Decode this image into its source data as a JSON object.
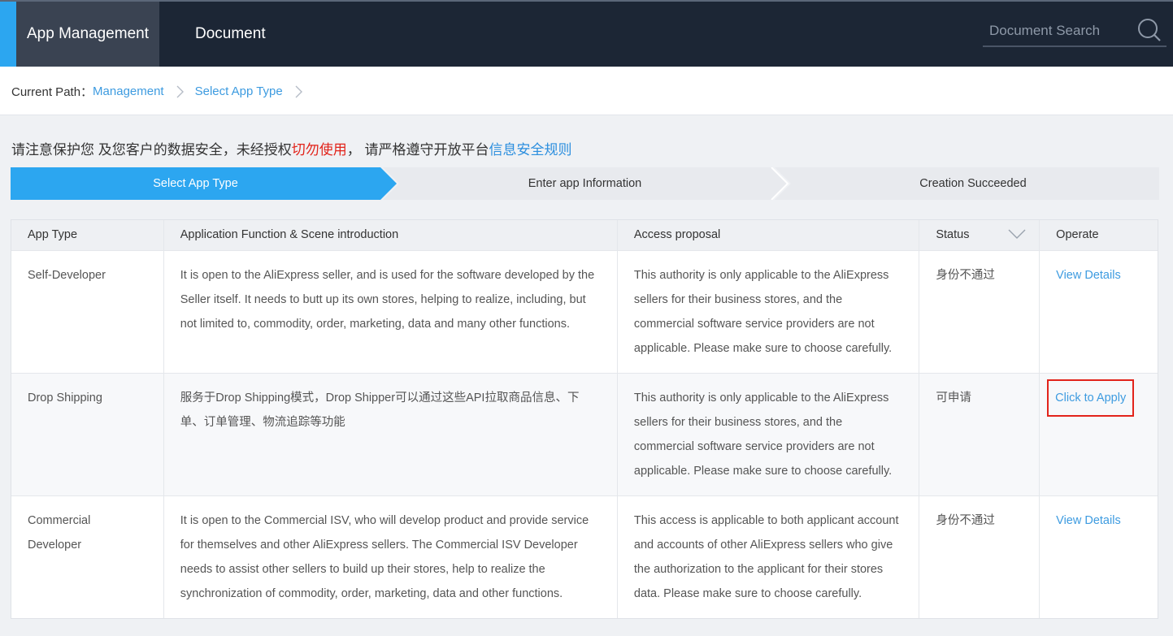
{
  "nav": {
    "items": [
      {
        "label": "App Management",
        "active": true
      },
      {
        "label": "Document",
        "active": false
      }
    ],
    "search_placeholder": "Document Search"
  },
  "breadcrumb": {
    "prefix": "Current Path：",
    "items": [
      "Management",
      "Select App Type"
    ]
  },
  "notice": {
    "part1": "请注意保护您 及您客户的数据安全，未经授权",
    "warning": "切勿使用",
    "part2": "， 请严格遵守开放平台",
    "link": "信息安全规则"
  },
  "steps": [
    {
      "label": "Select App Type",
      "state": "active"
    },
    {
      "label": "Enter app Information",
      "state": "pending"
    },
    {
      "label": "Creation Succeeded",
      "state": "pending"
    }
  ],
  "table": {
    "columns": [
      "App Type",
      "Application Function & Scene introduction",
      "Access proposal",
      "Status",
      "Operate"
    ],
    "rows": [
      {
        "type": "Self-Developer",
        "function": "It is open to the AliExpress seller, and is used for the software developed by the Seller itself. It needs to butt up its own stores, helping to realize, including, but not limited to, commodity, order, marketing, data and many other functions.",
        "proposal": "This authority is only applicable to the AliExpress sellers for their business stores, and the commercial software service providers are not applicable. Please make sure to choose carefully.",
        "status": "身份不通过",
        "operate": "View Details"
      },
      {
        "type": "Drop Shipping",
        "function": "服务于Drop Shipping模式，Drop Shipper可以通过这些API拉取商品信息、下单、订单管理、物流追踪等功能",
        "proposal": "This authority is only applicable to the AliExpress sellers for their business stores, and the commercial software service providers are not applicable. Please make sure to choose carefully.",
        "status": "可申请",
        "operate": "Click to Apply"
      },
      {
        "type": "Commercial Developer",
        "function": "It is open to the Commercial ISV, who will develop product and provide service for themselves and other AliExpress sellers. The Commercial ISV Developer needs to assist other sellers to build up their stores, help to realize the synchronization of commodity, order, marketing, data and other functions.",
        "proposal": "This access is applicable to both applicant account and accounts of other AliExpress sellers who give the authorization to the applicant for their stores data. Please make sure to choose carefully.",
        "status": "身份不通过",
        "operate": "View Details"
      }
    ]
  },
  "colors": {
    "nav_bg": "#1c2635",
    "accent": "#2ca6f0",
    "link": "#3d9be0",
    "warning": "#e2231a"
  }
}
